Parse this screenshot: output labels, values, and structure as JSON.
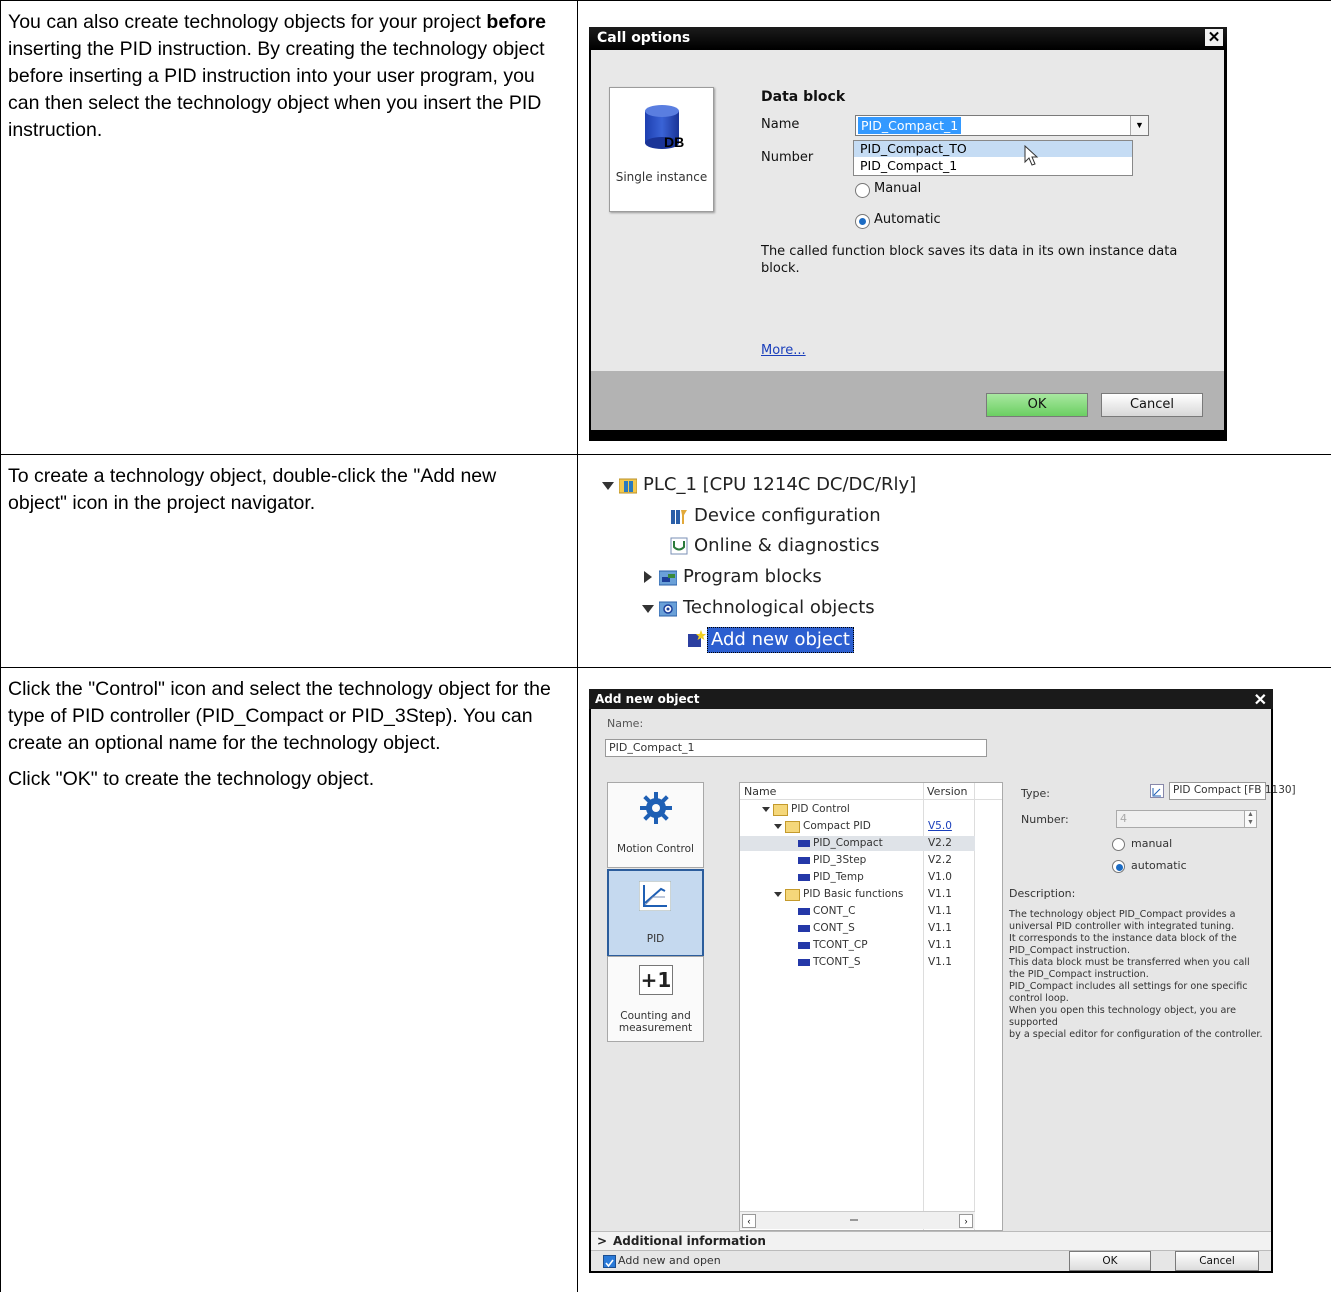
{
  "row1": {
    "text_before_bold": "You can also create technology objects for your project ",
    "bold": "before",
    "text_after_bold": " inserting the PID instruction. By creating the technology object before inserting a PID instruction into your user program, you can then select the technology object when you insert the PID instruction.",
    "dialog": {
      "title": "Call options",
      "close_glyph": "✕",
      "tile_db": "DB",
      "tile_label": "Single instance",
      "section_title": "Data block",
      "name_label": "Name",
      "number_label": "Number",
      "name_value": "PID_Compact_1",
      "dropdown_options": [
        "PID_Compact_TO",
        "PID_Compact_1"
      ],
      "radio_manual": "Manual",
      "radio_automatic": "Automatic",
      "radio_selected": "Automatic",
      "description": "The called function block saves its data in its own instance data block.",
      "more_link": "More...",
      "ok": "OK",
      "cancel": "Cancel"
    }
  },
  "row2": {
    "text": "To create a technology object, double-click the \"Add new object\" icon in the project navigator.",
    "tree": {
      "plc": "PLC_1 [CPU 1214C DC/DC/Rly]",
      "device_config": "Device configuration",
      "online": "Online & diagnostics",
      "program_blocks": "Program blocks",
      "tech_objects": "Technological objects",
      "add_new": "Add new object"
    }
  },
  "row3": {
    "text1": "Click the \"Control\" icon and select the technology object for the type of PID controller (PID_Compact or PID_3Step). You can create an optional name for the technology object.",
    "text2": "Click \"OK\" to create the technology object.",
    "dialog": {
      "title": "Add new object",
      "close_glyph": "✕",
      "name_label": "Name:",
      "name_value": "PID_Compact_1",
      "categories": [
        {
          "label": "Motion Control",
          "icon": "gear-icon"
        },
        {
          "label": "PID",
          "icon": "pid-chart-icon",
          "active": true
        },
        {
          "label": "Counting and measurement",
          "icon": "plus-one-icon",
          "glyph": "+1"
        }
      ],
      "col_name": "Name",
      "col_version": "Version",
      "items": [
        {
          "name": "PID Control",
          "version": "",
          "kind": "folder"
        },
        {
          "name": "Compact PID",
          "version": "V5.0",
          "kind": "folder"
        },
        {
          "name": "PID_Compact",
          "version": "V2.2",
          "kind": "block"
        },
        {
          "name": "PID_3Step",
          "version": "V2.2",
          "kind": "block"
        },
        {
          "name": "PID_Temp",
          "version": "V1.0",
          "kind": "block"
        },
        {
          "name": "PID Basic functions",
          "version": "V1.1",
          "kind": "folder"
        },
        {
          "name": "CONT_C",
          "version": "V1.1",
          "kind": "block"
        },
        {
          "name": "CONT_S",
          "version": "V1.1",
          "kind": "block"
        },
        {
          "name": "TCONT_CP",
          "version": "V1.1",
          "kind": "block"
        },
        {
          "name": "TCONT_S",
          "version": "V1.1",
          "kind": "block"
        }
      ],
      "type_label": "Type:",
      "type_value": "PID Compact [FB 1130]",
      "number_label": "Number:",
      "number_value": "4",
      "radio_manual": "manual",
      "radio_automatic": "automatic",
      "description_label": "Description:",
      "description": "The technology object PID_Compact provides a universal PID controller with integrated tuning.\nIt corresponds to the instance data block of the PID_Compact instruction.\nThis data block must be transferred when you call the PID_Compact instruction.\nPID_Compact includes all settings for one specific control loop.\nWhen you open this technology object, you are supported\nby a special editor for configuration of the controller.",
      "additional_info": "Additional information",
      "add_new_and_open": "Add new and open",
      "ok": "OK",
      "cancel": "Cancel"
    }
  }
}
